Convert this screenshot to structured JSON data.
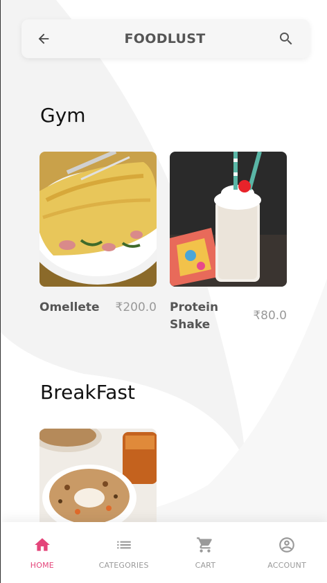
{
  "app": {
    "title": "FOODLUST",
    "accent_color": "#e4457a",
    "icons": {
      "back": "arrow-back-icon",
      "search": "search-icon"
    }
  },
  "sections": [
    {
      "title": "Gym",
      "items": [
        {
          "name": "Omellete",
          "price": "₹200.0",
          "image": "omelette-photo"
        },
        {
          "name": "Protein Shake",
          "price": "₹80.0",
          "image": "protein-shake-photo"
        }
      ]
    },
    {
      "title": "BreakFast",
      "items": [
        {
          "name": "",
          "price": "",
          "image": "oatmeal-bowl-photo"
        }
      ]
    }
  ],
  "bottom_nav": [
    {
      "label": "HOME",
      "icon": "home-icon",
      "active": true
    },
    {
      "label": "CATEGORIES",
      "icon": "list-icon",
      "active": false
    },
    {
      "label": "CART",
      "icon": "cart-icon",
      "active": false
    },
    {
      "label": "ACCOUNT",
      "icon": "account-icon",
      "active": false
    }
  ]
}
